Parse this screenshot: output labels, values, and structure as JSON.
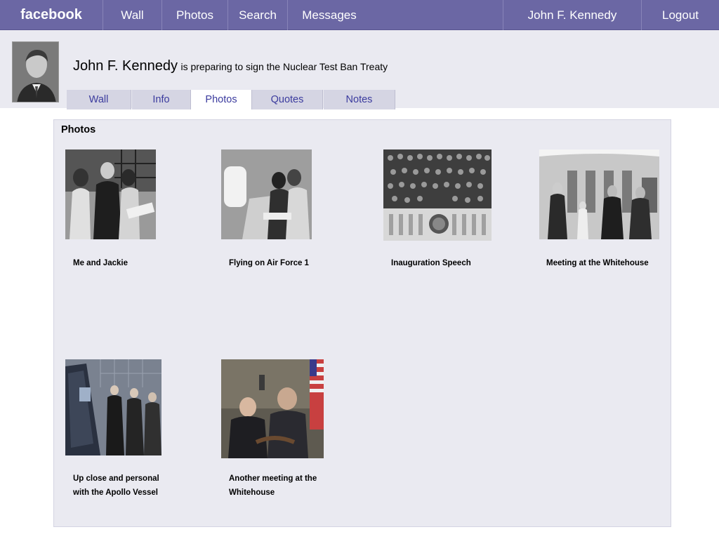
{
  "topnav": {
    "brand": "facebook",
    "items": [
      "Wall",
      "Photos",
      "Search",
      "Messages"
    ],
    "user": "John F. Kennedy",
    "logout": "Logout"
  },
  "profile": {
    "name": "John F. Kennedy",
    "status": "is preparing to sign the Nuclear Test Ban Treaty"
  },
  "tabs": [
    "Wall",
    "Info",
    "Photos",
    "Quotes",
    "Notes"
  ],
  "active_tab": "Photos",
  "photos_panel": {
    "title": "Photos",
    "photos": [
      {
        "caption": "Me and Jackie"
      },
      {
        "caption": "Flying on Air Force 1"
      },
      {
        "caption": "Inauguration Speech"
      },
      {
        "caption": "Meeting at the Whitehouse"
      },
      {
        "caption": "Up close and personal with the Apollo Vessel"
      },
      {
        "caption": "Another meeting at the Whitehouse"
      }
    ]
  },
  "colors": {
    "topbar": "#6b67a4",
    "band": "#eaeaf1",
    "tab_inactive": "#d5d5e3",
    "link": "#3b3b9e"
  }
}
